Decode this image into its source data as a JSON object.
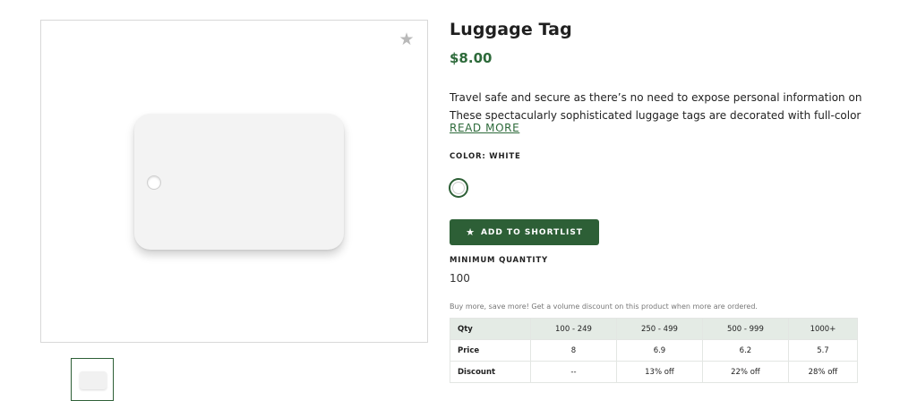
{
  "product": {
    "title": "Luggage Tag",
    "price": "$8.00",
    "description_lines": [
      "Travel safe and secure as there’s no need to expose personal information on this tag.",
      "These spectacularly sophisticated luggage tags are decorated with full-color photo…"
    ],
    "read_more_label": "READ MORE",
    "color_label": "COLOR: WHITE",
    "selected_color": "White",
    "swatch_color": "#ffffff",
    "accent_color": "#2d5f36",
    "price_color": "#2d6a3a"
  },
  "actions": {
    "shortlist_label": "ADD TO SHORTLIST",
    "shortlist_icon": "star-icon",
    "favorite_icon": "star-icon"
  },
  "quantity": {
    "label": "MINIMUM QUANTITY",
    "value": "100"
  },
  "pricing": {
    "note": "Buy more, save more! Get a volume discount on this product when more are ordered.",
    "header": [
      "Qty",
      "100 - 249",
      "250 - 499",
      "500 - 999",
      "1000+"
    ],
    "rows": [
      [
        "Price",
        "8",
        "6.9",
        "6.2",
        "5.7"
      ],
      [
        "Discount",
        "--",
        "13% off",
        "22% off",
        "28% off"
      ]
    ]
  }
}
